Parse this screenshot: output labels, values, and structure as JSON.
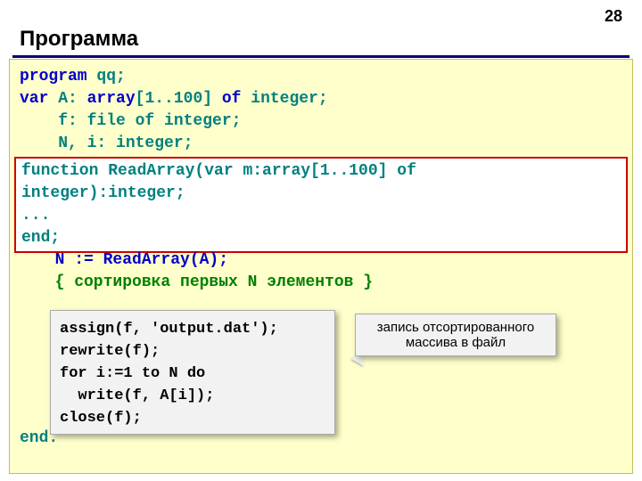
{
  "page_number": "28",
  "title": "Программа",
  "code": {
    "line1a": "program",
    "line1b": " qq;",
    "line2a": "var",
    "line2b": " A: ",
    "line2c": "array",
    "line2d": "[1..100] ",
    "line2e": "of",
    "line2f": " integer;",
    "line3": "    f: file of integer;",
    "line4": "    N, i: integer;",
    "func1": "function ReadArray(var m:array[1..100] of",
    "func2": "integer):integer;",
    "func3": "...",
    "func4": "end;",
    "call": "  N := ReadArray(A);",
    "comment": "  { сортировка первых N элементов }",
    "g1": "assign(f, 'output.dat');",
    "g2": "rewrite(f);",
    "g3": "for i:=1 to N do",
    "g4": "  write(f, A[i]);",
    "g5": "close(f);",
    "end": "end."
  },
  "callout": {
    "line1": "запись отсортированного",
    "line2": "массива в файл"
  }
}
